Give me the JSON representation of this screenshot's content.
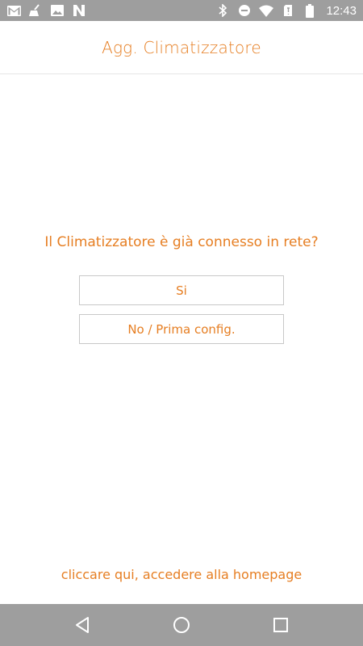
{
  "status_bar": {
    "time": "12:43",
    "left_icons": [
      "gmail-icon",
      "cleaner-icon",
      "image-icon",
      "n-icon"
    ],
    "right_icons": [
      "bluetooth-icon",
      "do-not-disturb-icon",
      "wifi-icon",
      "no-sim-icon",
      "battery-icon"
    ]
  },
  "header": {
    "title": "Agg. Climatizzatore"
  },
  "main": {
    "question": "Il Climatizzatore è già connesso in rete?",
    "options": [
      {
        "label": "Si"
      },
      {
        "label": "No / Prima config."
      }
    ]
  },
  "footer": {
    "link": "cliccare qui, accedere alla homepage"
  },
  "navigation": {
    "buttons": [
      "back-icon",
      "home-icon",
      "recents-icon"
    ]
  },
  "colors": {
    "accent": "#e67e22",
    "bars": "#9e9e9e"
  }
}
